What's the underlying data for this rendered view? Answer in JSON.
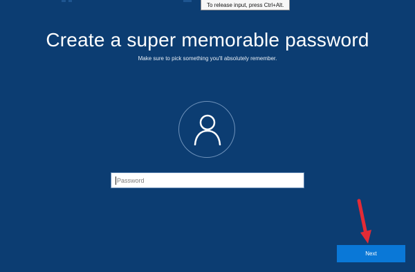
{
  "tooltip": {
    "text": "To release input, press Ctrl+Alt."
  },
  "header": {
    "title": "Create a super memorable password",
    "subtitle": "Make sure to pick something you'll absolutely remember."
  },
  "avatar": {
    "icon": "user-icon"
  },
  "password": {
    "placeholder": "Password",
    "value": ""
  },
  "actions": {
    "next_label": "Next"
  },
  "annotation": {
    "icon": "red-arrow-icon",
    "color": "#e32b36"
  },
  "colors": {
    "background": "#0c3d72",
    "accent": "#0a78d7",
    "field_border": "#5f86b3"
  }
}
